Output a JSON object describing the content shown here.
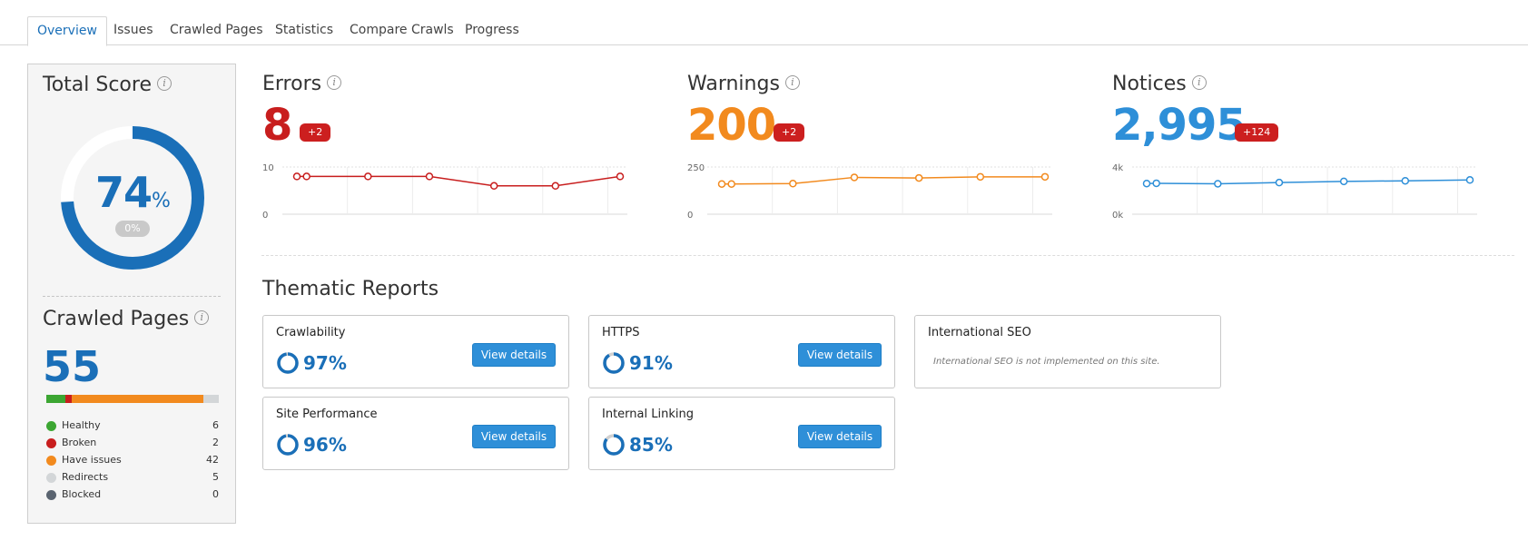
{
  "tabs": [
    {
      "label": "Overview",
      "active": true
    },
    {
      "label": "Issues",
      "active": false
    },
    {
      "label": "Crawled Pages",
      "active": false
    },
    {
      "label": "Statistics",
      "active": false
    },
    {
      "label": "Compare Crawls",
      "active": false
    },
    {
      "label": "Progress",
      "active": false
    }
  ],
  "total_score": {
    "title": "Total Score",
    "value": "74",
    "unit": "%",
    "score_fraction": 0.74,
    "change_badge": "0%",
    "ring_color": "#1a6fb8"
  },
  "crawled_pages": {
    "title": "Crawled Pages",
    "count": "55",
    "segments": [
      {
        "label": "Healthy",
        "count": "6",
        "value": 6,
        "color": "#3ca632"
      },
      {
        "label": "Broken",
        "count": "2",
        "value": 2,
        "color": "#c81e1e"
      },
      {
        "label": "Have issues",
        "count": "42",
        "value": 42,
        "color": "#f28a1e"
      },
      {
        "label": "Redirects",
        "count": "5",
        "value": 5,
        "color": "#d3d6d8"
      },
      {
        "label": "Blocked",
        "count": "0",
        "value": 0,
        "color": "#5a6470"
      }
    ]
  },
  "metrics": {
    "errors": {
      "title": "Errors",
      "value": "8",
      "delta": "+2",
      "color": "#c81e1e",
      "y_top_label": "10",
      "y_bottom_label": "0",
      "y_max": 10,
      "points": [
        8,
        8,
        8,
        8,
        6,
        6,
        8
      ],
      "point_x": [
        0,
        0.03,
        0.22,
        0.41,
        0.61,
        0.8,
        1.0
      ]
    },
    "warnings": {
      "title": "Warnings",
      "value": "200",
      "delta": "+2",
      "color": "#f28a1e",
      "y_top_label": "250",
      "y_bottom_label": "0",
      "y_max": 250,
      "points": [
        160,
        160,
        162,
        195,
        192,
        198,
        198
      ],
      "point_x": [
        0,
        0.03,
        0.22,
        0.41,
        0.61,
        0.8,
        1.0
      ]
    },
    "notices": {
      "title": "Notices",
      "value": "2,995",
      "delta": "+124",
      "color": "#2e8fd8",
      "y_top_label": "4k",
      "y_bottom_label": "0k",
      "y_max": 4000,
      "points": [
        2600,
        2620,
        2580,
        2680,
        2780,
        2830,
        2900
      ],
      "point_x": [
        0,
        0.03,
        0.22,
        0.41,
        0.61,
        0.8,
        1.0
      ]
    }
  },
  "thematic": {
    "title": "Thematic Reports",
    "view_label": "View details",
    "reports": [
      {
        "name": "Crawlability",
        "value": "97%",
        "fraction": 0.97
      },
      {
        "name": "HTTPS",
        "value": "91%",
        "fraction": 0.91
      },
      {
        "name": "International SEO",
        "note": "International SEO is not implemented on this site."
      },
      {
        "name": "Site Performance",
        "value": "96%",
        "fraction": 0.96
      },
      {
        "name": "Internal Linking",
        "value": "85%",
        "fraction": 0.85
      }
    ]
  },
  "colors": {
    "accent": "#1a6fb8",
    "button": "#2e8fd8",
    "badge_red": "#cc1f1f"
  }
}
